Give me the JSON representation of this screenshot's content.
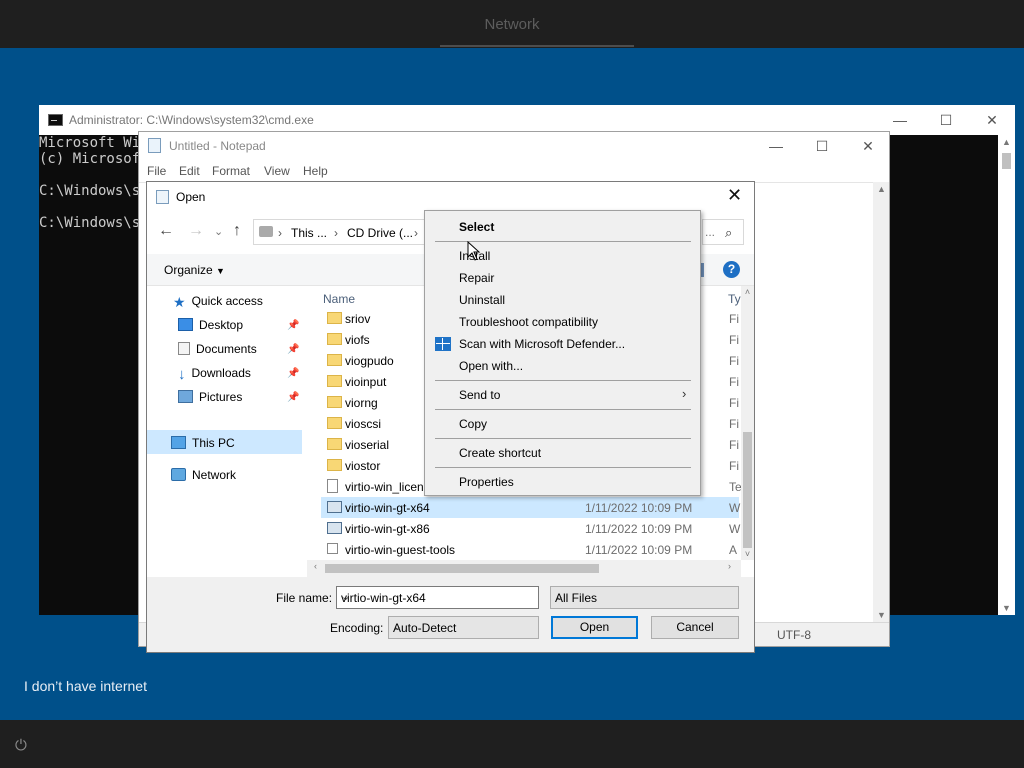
{
  "topbar": {
    "title": "Network"
  },
  "footer": {
    "no_internet": "I don’t have internet"
  },
  "cmd": {
    "title": "Administrator: C:\\Windows\\system32\\cmd.exe",
    "lines": [
      "Microsoft Wi",
      "(c) Microsof",
      "",
      "C:\\Windows\\sy",
      "",
      "C:\\Windows\\sy"
    ]
  },
  "notepad": {
    "title": "Untitled - Notepad",
    "menu": [
      "File",
      "Edit",
      "Format",
      "View",
      "Help"
    ],
    "status_encoding": "UTF-8"
  },
  "open_dialog": {
    "title": "Open",
    "address": [
      "This ...",
      "CD Drive (..."
    ],
    "organize": "Organize",
    "nav_tree": [
      {
        "label": "Quick access",
        "pinned": false
      },
      {
        "label": "Desktop",
        "pinned": true
      },
      {
        "label": "Documents",
        "pinned": true
      },
      {
        "label": "Downloads",
        "pinned": true
      },
      {
        "label": "Pictures",
        "pinned": true
      },
      {
        "label": "This PC",
        "pinned": false,
        "selected": true
      },
      {
        "label": "Network",
        "pinned": false
      }
    ],
    "columns": {
      "name": "Name",
      "type": "Ty"
    },
    "files": [
      {
        "name": "sriov",
        "date": "",
        "type": "Fi",
        "kind": "folder"
      },
      {
        "name": "viofs",
        "date": "",
        "type": "Fi",
        "kind": "folder"
      },
      {
        "name": "viogpudo",
        "date": "",
        "type": "Fi",
        "kind": "folder"
      },
      {
        "name": "vioinput",
        "date": "",
        "type": "Fi",
        "kind": "folder"
      },
      {
        "name": "viorng",
        "date": "",
        "type": "Fi",
        "kind": "folder"
      },
      {
        "name": "vioscsi",
        "date": "",
        "type": "Fi",
        "kind": "folder"
      },
      {
        "name": "vioserial",
        "date": "",
        "type": "Fi",
        "kind": "folder"
      },
      {
        "name": "viostor",
        "date": "",
        "type": "Fi",
        "kind": "folder"
      },
      {
        "name": "virtio-win_licen",
        "date": "",
        "type": "Te",
        "kind": "file"
      },
      {
        "name": "virtio-win-gt-x64",
        "date": "1/11/2022 10:09 PM",
        "type": "W",
        "kind": "msi",
        "selected": true
      },
      {
        "name": "virtio-win-gt-x86",
        "date": "1/11/2022 10:09 PM",
        "type": "W",
        "kind": "msi"
      },
      {
        "name": "virtio-win-guest-tools",
        "date": "1/11/2022 10:09 PM",
        "type": "A",
        "kind": "exe"
      }
    ],
    "file_name_label": "File name:",
    "file_name_value": "virtio-win-gt-x64",
    "filter_value": "All Files",
    "encoding_label": "Encoding:",
    "encoding_value": "Auto-Detect",
    "open_label": "Open",
    "cancel_label": "Cancel"
  },
  "context_menu": {
    "items": [
      "Select",
      "Install",
      "Repair",
      "Uninstall",
      "Troubleshoot compatibility",
      "Scan with Microsoft Defender...",
      "Open with...",
      "Send to",
      "Copy",
      "Create shortcut",
      "Properties"
    ]
  },
  "colors": {
    "accent": "#0078d7",
    "oobe_blue": "#00508a",
    "selection": "#cce8ff"
  }
}
